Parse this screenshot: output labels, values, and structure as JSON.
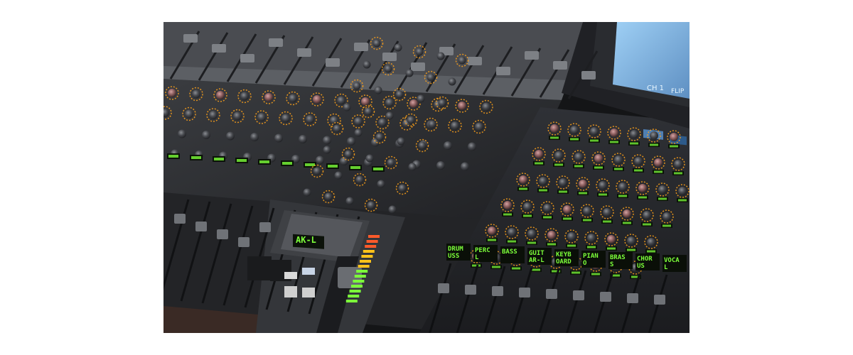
{
  "photo": {
    "colors": {
      "panel": "#2b2d31",
      "knob": "#3b3d41",
      "led_green": "#7cff3a",
      "led_amber": "#ffa21a",
      "screen": "#7fb8e6",
      "table": "#3a2a25"
    },
    "screen": {
      "channel_label": "CH 1",
      "button_label": "FLIP"
    },
    "center_lcd": {
      "text": "AK-L"
    },
    "strip_lcds": [
      {
        "line1": "DRUM",
        "line2": "USS"
      },
      {
        "line1": "PERC",
        "line2": "L"
      },
      {
        "line1": "BASS",
        "line2": ""
      },
      {
        "line1": "GUIT",
        "line2": "AR-L"
      },
      {
        "line1": "KEYB",
        "line2": "OARD"
      },
      {
        "line1": "PIAN",
        "line2": "O"
      },
      {
        "line1": "BRAS",
        "line2": "S"
      },
      {
        "line1": "CHOR",
        "line2": "US"
      },
      {
        "line1": "VOCA",
        "line2": "L"
      }
    ]
  }
}
